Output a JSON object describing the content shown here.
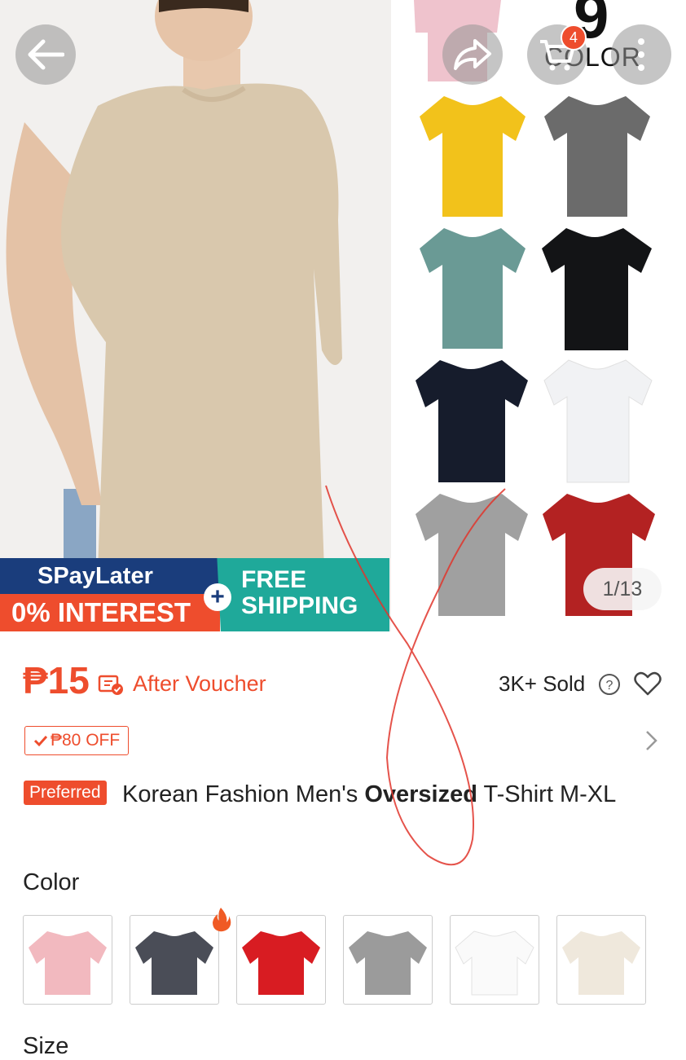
{
  "product_image": {
    "page_counter": "1/13",
    "color_count_number": "9",
    "color_count_label": "COLOR",
    "cart_badge": "4",
    "banner": {
      "spaylater": "SPayLater",
      "interest": "0% INTEREST",
      "free_shipping_line1": "FREE",
      "free_shipping_line2": "SHIPPING"
    },
    "icons": [
      "back-arrow-icon",
      "share-icon",
      "cart-icon",
      "more-icon"
    ]
  },
  "pricing": {
    "price": "₱15",
    "after_voucher": "After Voucher",
    "sold": "3K+ Sold",
    "discount_tag": "₱80 OFF"
  },
  "product": {
    "preferred_label": "Preferred",
    "title_part1": "Korean Fashion Men's ",
    "title_bold": "Oversized",
    "title_part2": " T-Shirt M-XL"
  },
  "variations": {
    "color_label": "Color",
    "colors": [
      "pink",
      "charcoal",
      "red",
      "gray",
      "white",
      "cream"
    ],
    "size_label": "Size"
  },
  "colors": {
    "accent": "#ee4d2d",
    "spaylater_blue": "#1a3d7c",
    "shipping_teal": "#1fa99a"
  }
}
